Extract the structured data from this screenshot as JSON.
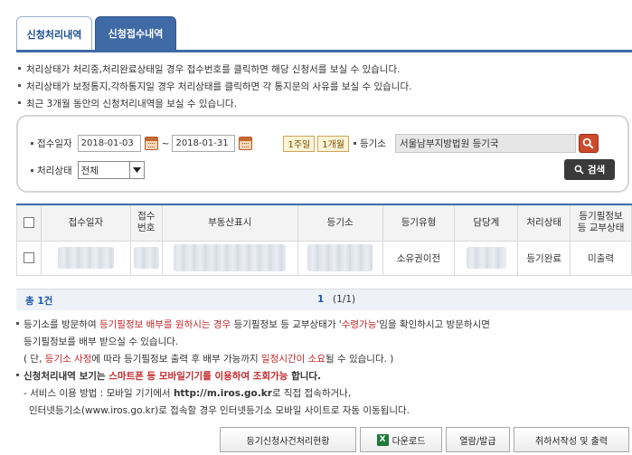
{
  "tabs": [
    "신청처리내역",
    "신청접수내역"
  ],
  "info_lines": [
    "처리상태가 처리중,처리완료상태일 경우 접수번호를 클릭하면 해당 신청서를 보실 수 있습니다.",
    "처리상태가 보정통지,각하통지일 경우 처리상태를 클릭하면 각 통지문의 사유를 보실 수 있습니다.",
    "최근 3개월 동안의 신청처리내역을 보실 수 있습니다."
  ],
  "search": {
    "date_label": "접수일자",
    "date_from": "2018-01-03",
    "date_sep": "~",
    "date_to": "2018-01-31",
    "week_btn": "1주일",
    "month_btn": "1개월",
    "registry_label": "등기소",
    "registry_value": "서울남부지방법원 등기국",
    "status_label": "처리상태",
    "status_value": "전체",
    "search_btn": "검색"
  },
  "table": {
    "headers": [
      "접수일자",
      "접수\n번호",
      "부동산표시",
      "등기소",
      "등기유형",
      "담당계",
      "처리상태",
      "등기필정보\n등 교부상태"
    ],
    "rows": [
      {
        "type": "소유권이전",
        "status": "등기완료",
        "issue": "미출력"
      }
    ]
  },
  "pager": {
    "total_prefix": "총",
    "total_count": "1",
    "total_suffix": "건",
    "current": "1",
    "of": "(1/1)"
  },
  "notes": {
    "n1a": "등기소를 방문하여 ",
    "n1b": "등기필정보 배부를 원하시는 경우",
    "n1c": " 등기필정보 등 교부상태가 '",
    "n1d": "수령가능",
    "n1e": "'임을 확인하시고 방문하시면",
    "n1f": "등기필정보를 배부 받으실 수 있습니다.",
    "n2a": "( 단, ",
    "n2b": "등기소 사정",
    "n2c": "에 따라 등기필정보 출력 후 배부 가능까지 ",
    "n2d": "일정시간이 소요",
    "n2e": "될 수 있습니다. )",
    "n3a": "신청처리내역 보기는 ",
    "n3b": "스마트폰 등 모바일기기를 이용하여 조회가능",
    "n3c": " 합니다.",
    "n4a": "- 서비스 이용 방법 : 모바일 기기에서 ",
    "n4b": "http://m.iros.go.kr",
    "n4c": "로 직접 접속하거나,",
    "n5": "인터넷등기소(www.iros.go.kr)로 접속할 경우 인터넷등기소 모바일 사이트로 자동 이동됩니다."
  },
  "buttons": {
    "status_btn": "등기신청사건처리현황",
    "download_btn": "다운로드",
    "view_btn": "열람/발급",
    "withdraw_btn": "취하서작성 및 출력"
  }
}
